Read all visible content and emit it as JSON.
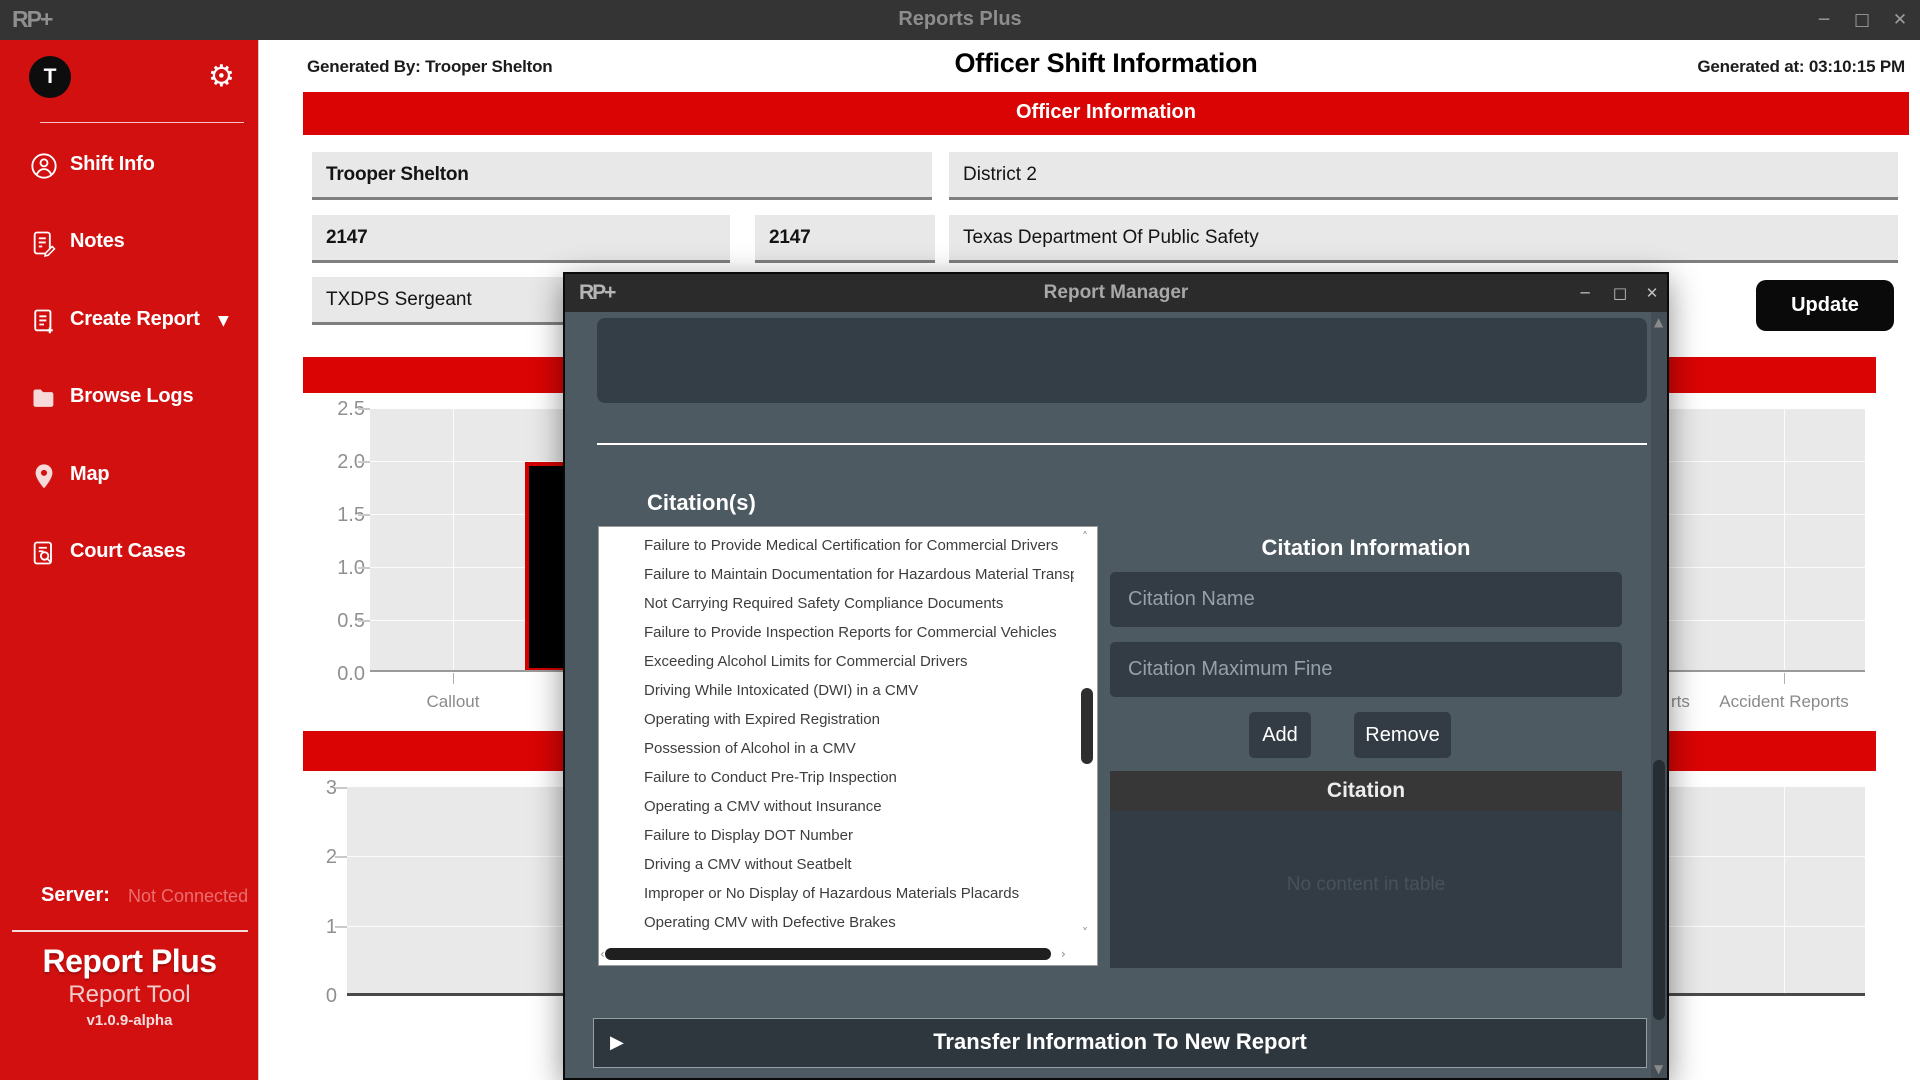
{
  "titlebar": {
    "logo": "RP+",
    "title": "Reports Plus",
    "minimize": "─",
    "maximize": "□",
    "close": "✕"
  },
  "sidebar": {
    "avatar_letter": "T",
    "gear_glyph": "⚙",
    "items": [
      {
        "label": "Shift Info"
      },
      {
        "label": "Notes"
      },
      {
        "label": "Create Report",
        "caret": "▼"
      },
      {
        "label": "Browse Logs"
      },
      {
        "label": "Map"
      },
      {
        "label": "Court Cases"
      }
    ],
    "server_label": "Server:",
    "server_status": "Not Connected",
    "brand_title": "Report Plus",
    "brand_subtitle": "Report Tool",
    "version": "v1.0.9-alpha"
  },
  "header": {
    "generated_by": "Generated By: Trooper Shelton",
    "title": "Officer Shift Information",
    "generated_at": "Generated at: 03:10:15 PM",
    "section_title": "Officer Information"
  },
  "form": {
    "officer_name": "Trooper Shelton",
    "district": "District 2",
    "badge_number": "2147",
    "unit_number": "2147",
    "department": "Texas Department Of Public Safety",
    "rank": "TXDPS Sergeant",
    "update_label": "Update"
  },
  "chart_data": [
    {
      "type": "bar",
      "ylim": [
        0,
        2.5
      ],
      "yticks": [
        "2.5",
        "2.0",
        "1.5",
        "1.0",
        "0.5",
        "0.0"
      ],
      "categories_visible": [
        "Callout",
        "rts",
        "Accident Reports"
      ],
      "bars_visible": [
        {
          "category_slot": "second (label hidden behind dialog)",
          "value": 2.0,
          "fill": "#000000",
          "border": "#d40000"
        }
      ],
      "grid": true,
      "plot_bg": "#e9e9e9"
    },
    {
      "type": "bar",
      "ylim": [
        0,
        3
      ],
      "yticks": [
        "3",
        "2",
        "1",
        "0"
      ],
      "categories_visible": [],
      "bars_visible": [],
      "grid": true,
      "plot_bg": "#e9e9e9"
    }
  ],
  "modal": {
    "logo": "RP+",
    "title": "Report Manager",
    "minimize": "─",
    "maximize": "□",
    "close": "✕",
    "citations_heading": "Citation(s)",
    "citation_list": [
      "Failure to Provide Medical Certification for Commercial Drivers",
      "Failure to Maintain Documentation for Hazardous Material Transp",
      "Not Carrying Required Safety Compliance Documents",
      "Failure to Provide Inspection Reports for Commercial Vehicles",
      "Exceeding Alcohol Limits for Commercial Drivers",
      "Driving While Intoxicated (DWI) in a CMV",
      "Operating with Expired Registration",
      "Possession of Alcohol in a CMV",
      "Failure to Conduct Pre-Trip Inspection",
      "Operating a CMV without Insurance",
      "Failure to Display DOT Number",
      "Driving a CMV without Seatbelt",
      "Improper or No Display of Hazardous Materials Placards",
      "Operating CMV with Defective Brakes"
    ],
    "info_heading": "Citation Information",
    "name_placeholder": "Citation Name",
    "fine_placeholder": "Citation Maximum Fine",
    "add_label": "Add",
    "remove_label": "Remove",
    "table_header": "Citation",
    "table_empty": "No content in table",
    "transfer_label": "Transfer Information To New Report",
    "scroll": {
      "up": "▲",
      "down": "▼",
      "chev_up": "˄",
      "chev_down": "˅",
      "chev_left": "‹",
      "chev_right": "›",
      "play": "▶"
    }
  }
}
